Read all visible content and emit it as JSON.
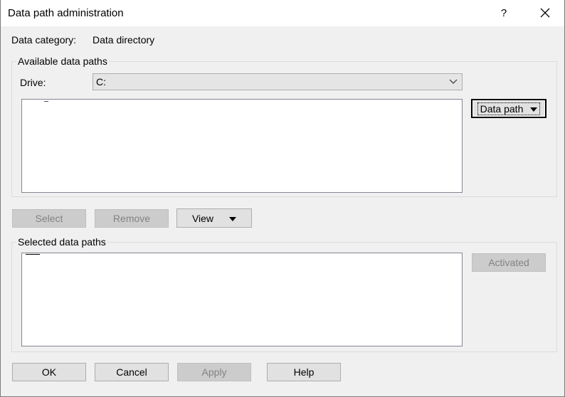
{
  "window": {
    "title": "Data path administration",
    "help_glyph": "?",
    "close_glyph": "✕"
  },
  "data_category": {
    "label": "Data category:",
    "value": "Data directory"
  },
  "available": {
    "group_title": "Available data paths",
    "drive_label": "Drive:",
    "drive_value": "C:",
    "data_path_button": "Data path"
  },
  "actions": {
    "select": "Select",
    "remove": "Remove",
    "view": "View"
  },
  "selected": {
    "group_title": "Selected data paths",
    "activated_button": "Activated"
  },
  "footer": {
    "ok": "OK",
    "cancel": "Cancel",
    "apply": "Apply",
    "help": "Help"
  }
}
